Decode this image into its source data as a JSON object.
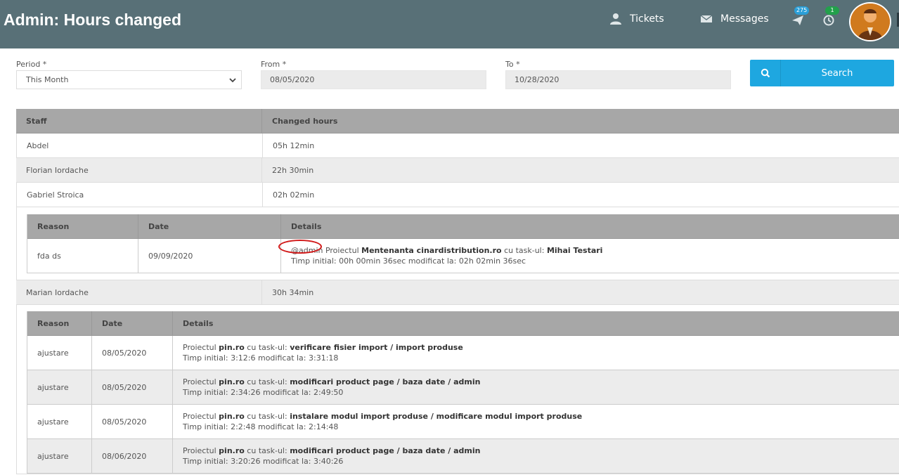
{
  "header": {
    "title": "Admin: Hours changed",
    "nav": {
      "tickets": "Tickets",
      "messages": "Messages"
    },
    "notifications": {
      "sent_count": "275",
      "history_count": "1"
    },
    "colors": {
      "bar": "#587077",
      "accent": "#1ea7e0"
    }
  },
  "filters": {
    "period_label": "Period *",
    "period_value": "This Month",
    "from_label": "From *",
    "from_value": "08/05/2020",
    "to_label": "To *",
    "to_value": "10/28/2020",
    "search_label": "Search"
  },
  "table": {
    "headers": {
      "staff": "Staff",
      "changed_hours": "Changed hours"
    },
    "rows": [
      {
        "staff": "Abdel",
        "hours": "05h 12min"
      },
      {
        "staff": "Florian Iordache",
        "hours": "22h 30min"
      },
      {
        "staff": "Gabriel Stroica",
        "hours": "02h 02min"
      },
      {
        "staff": "Marian Iordache",
        "hours": "30h 34min"
      }
    ]
  },
  "detail_gabriel": {
    "headers": {
      "reason": "Reason",
      "date": "Date",
      "details": "Details"
    },
    "row": {
      "reason": "fda ds",
      "date": "09/09/2020",
      "mention": "@admin",
      "pre": " Proiectul ",
      "project": "Mentenanta cinardistribution.ro",
      "mid": " cu task-ul: ",
      "task": "Mihai Testari",
      "line2": "Timp initial: 00h 00min 36sec modificat la: 02h 02min 36sec"
    }
  },
  "detail_marian": {
    "headers": {
      "reason": "Reason",
      "date": "Date",
      "details": "Details"
    },
    "pre": "Proiectul ",
    "mid": " cu task-ul: ",
    "rows": [
      {
        "reason": "ajustare",
        "date": "08/05/2020",
        "project": "pin.ro",
        "task": "verificare fisier import / import produse",
        "line2": "Timp initial: 3:12:6 modificat la: 3:31:18"
      },
      {
        "reason": "ajustare",
        "date": "08/05/2020",
        "project": "pin.ro",
        "task": "modificari product page / baza date / admin",
        "line2": "Timp initial: 2:34:26 modificat la: 2:49:50"
      },
      {
        "reason": "ajustare",
        "date": "08/05/2020",
        "project": "pin.ro",
        "task": "instalare modul import produse / modificare modul import produse",
        "line2": "Timp initial: 2:2:48 modificat la: 2:14:48"
      },
      {
        "reason": "ajustare",
        "date": "08/06/2020",
        "project": "pin.ro",
        "task": "modificari product page / baza date / admin",
        "line2": "Timp initial: 3:20:26 modificat la: 3:40:26"
      }
    ]
  }
}
